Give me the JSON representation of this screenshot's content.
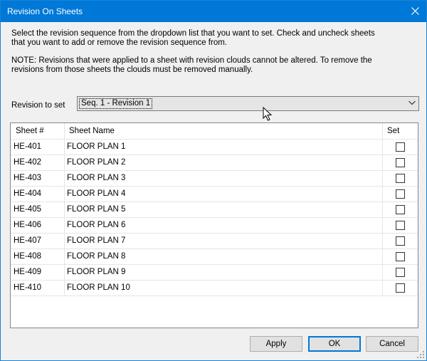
{
  "window": {
    "title": "Revision On Sheets",
    "close_icon": "close-icon"
  },
  "description": {
    "line1": "Select the revision sequence from the dropdown list that you want to set. Check and uncheck sheets",
    "line2": "that you want to add or remove the revision sequence from.",
    "note1": "NOTE: Revisions that were applied to a sheet with revision clouds cannot be altered. To remove the",
    "note2": "revisions from those sheets the clouds must be removed manually."
  },
  "revision": {
    "label": "Revision to set",
    "selected": "Seq. 1 - Revision 1"
  },
  "table": {
    "headers": {
      "sheet_number": "Sheet #",
      "sheet_name": "Sheet Name",
      "set": "Set"
    },
    "rows": [
      {
        "number": "HE-401",
        "name": "FLOOR PLAN 1",
        "set": false
      },
      {
        "number": "HE-402",
        "name": "FLOOR PLAN 2",
        "set": false
      },
      {
        "number": "HE-403",
        "name": "FLOOR PLAN 3",
        "set": false
      },
      {
        "number": "HE-404",
        "name": "FLOOR PLAN 4",
        "set": false
      },
      {
        "number": "HE-405",
        "name": "FLOOR PLAN 5",
        "set": false
      },
      {
        "number": "HE-406",
        "name": "FLOOR PLAN 6",
        "set": false
      },
      {
        "number": "HE-407",
        "name": "FLOOR PLAN 7",
        "set": false
      },
      {
        "number": "HE-408",
        "name": "FLOOR PLAN 8",
        "set": false
      },
      {
        "number": "HE-409",
        "name": "FLOOR PLAN 9",
        "set": false
      },
      {
        "number": "HE-410",
        "name": "FLOOR PLAN 10",
        "set": false
      }
    ]
  },
  "buttons": {
    "apply": "Apply",
    "ok": "OK",
    "cancel": "Cancel"
  },
  "colors": {
    "titlebar": "#0078d7",
    "button_focus": "#0078d7"
  }
}
